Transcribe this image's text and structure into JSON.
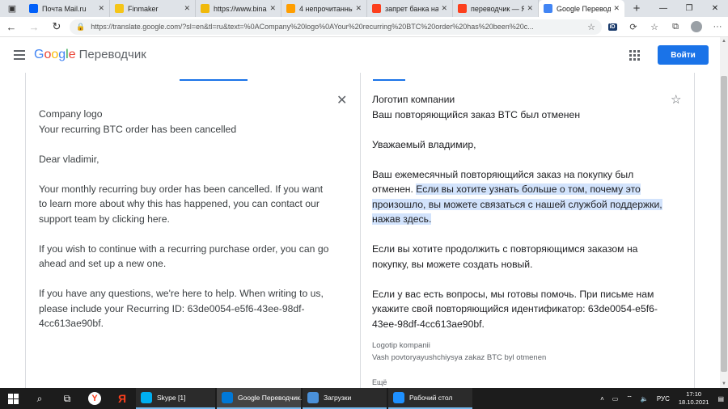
{
  "browser": {
    "tabs": [
      {
        "label": "Почта Mail.ru",
        "icon": "mail-ru-icon",
        "color": "#005ff9"
      },
      {
        "label": "Finmaker",
        "icon": "finmaker-icon",
        "color": "#f5c518"
      },
      {
        "label": "https://www.bina",
        "icon": "binance-icon",
        "color": "#f0b90b"
      },
      {
        "label": "4 непрочитанны",
        "icon": "envelope-icon",
        "color": "#ff9e00"
      },
      {
        "label": "запрет банка на",
        "icon": "yandex-icon",
        "color": "#fc3f1d"
      },
      {
        "label": "переводчик — Я",
        "icon": "yandex-icon",
        "color": "#fc3f1d"
      },
      {
        "label": "Google Переводч",
        "icon": "google-translate-icon",
        "color": "#4285f4"
      }
    ],
    "url": "https://translate.google.com/?sl=en&tl=ru&text=%0ACompany%20logo%0AYour%20recurring%20BTC%20order%20has%20been%20c..."
  },
  "header": {
    "logo": [
      "G",
      "o",
      "o",
      "g",
      "l",
      "e"
    ],
    "product": "Переводчик",
    "signin": "Войти"
  },
  "source": {
    "paragraphs": [
      "Company logo\nYour recurring BTC order has been cancelled",
      "Dear vladimir,",
      "Your monthly recurring buy order has been cancelled. If you want to learn more about why this has happened, you can contact our support team by clicking here.",
      "If you wish to continue with a recurring purchase order, you can go ahead and set up a new one.",
      "If you have any questions, we're here to help. When writing to us, please include your Recurring ID: 63de0054-e5f6-43ee-98df-4cc613ae90bf."
    ]
  },
  "target": {
    "p1": "Логотип компании\nВаш повторяющийся заказ BTC был отменен",
    "p2": "Уважаемый владимир,",
    "p3_plain": "Ваш ежемесячный повторяющийся заказ на покупку был отменен. ",
    "p3_highlight": "Если вы хотите узнать больше о том, почему это произошло, вы можете связаться с нашей службой поддержки, нажав здесь.",
    "p4": "Если вы хотите продолжить с повторяющимся заказом на покупку, вы можете создать новый.",
    "p5": "Если у вас есть вопросы, мы готовы помочь. При письме нам укажите свой повторяющийся идентификатор: 63de0054-e5f6-43ee-98df-4cc613ae90bf.",
    "transliteration": "Logotip kompanii\nVash povtoryayushchiysya zakaz BTC byl otmenen",
    "more": "Ещё"
  },
  "taskbar": {
    "apps": [
      {
        "label": "Skype [1]",
        "color": "#00aff0"
      },
      {
        "label": "Google Переводчик...",
        "color": "#0078d7"
      },
      {
        "label": "Загрузки",
        "color": "#4a90d9"
      },
      {
        "label": "Рабочий стол",
        "color": "#1e90ff"
      }
    ],
    "language": "РУС",
    "time": "17:10",
    "date": "18.10.2021"
  }
}
